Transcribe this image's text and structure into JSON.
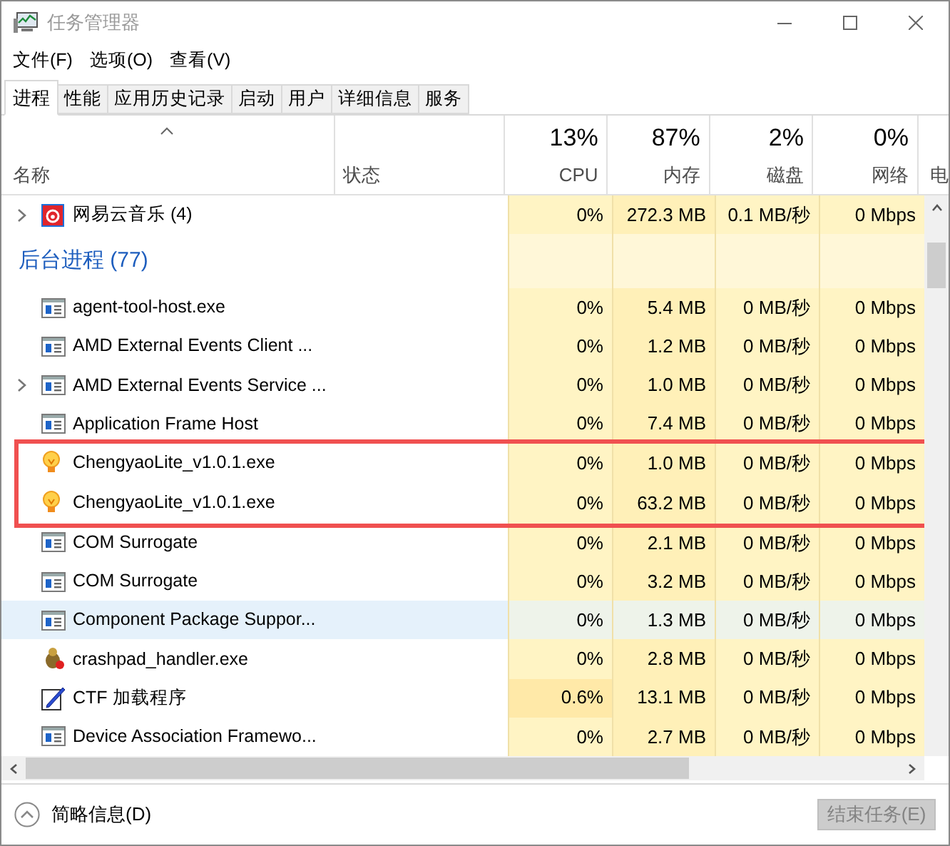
{
  "window": {
    "title": "任务管理器"
  },
  "menu": [
    "文件(F)",
    "选项(O)",
    "查看(V)"
  ],
  "tabs": [
    {
      "label": "进程",
      "selected": true
    },
    {
      "label": "性能",
      "selected": false
    },
    {
      "label": "应用历史记录",
      "selected": false
    },
    {
      "label": "启动",
      "selected": false
    },
    {
      "label": "用户",
      "selected": false
    },
    {
      "label": "详细信息",
      "selected": false
    },
    {
      "label": "服务",
      "selected": false
    }
  ],
  "columns": [
    {
      "label": "名称"
    },
    {
      "label": "状态"
    },
    {
      "label": "CPU",
      "percent": "13%"
    },
    {
      "label": "内存",
      "percent": "87%"
    },
    {
      "label": "磁盘",
      "percent": "2%"
    },
    {
      "label": "网络",
      "percent": "0%"
    },
    {
      "label": "电"
    }
  ],
  "rows": [
    {
      "kind": "music",
      "name": "网易云音乐 (4)",
      "expandable": true,
      "selected": false,
      "highlighted": false,
      "cpu": "0%",
      "memory": "272.3 MB",
      "disk": "0.1 MB/秒",
      "network": "0 Mbps"
    },
    {
      "kind": "group",
      "name": "后台进程 (77)"
    },
    {
      "kind": "window",
      "name": "agent-tool-host.exe",
      "expandable": false,
      "selected": false,
      "highlighted": false,
      "cpu": "0%",
      "memory": "5.4 MB",
      "disk": "0 MB/秒",
      "network": "0 Mbps"
    },
    {
      "kind": "window",
      "name": "AMD External Events Client ...",
      "expandable": false,
      "selected": false,
      "highlighted": false,
      "cpu": "0%",
      "memory": "1.2 MB",
      "disk": "0 MB/秒",
      "network": "0 Mbps"
    },
    {
      "kind": "window",
      "name": "AMD External Events Service ...",
      "expandable": true,
      "selected": false,
      "highlighted": false,
      "cpu": "0%",
      "memory": "1.0 MB",
      "disk": "0 MB/秒",
      "network": "0 Mbps"
    },
    {
      "kind": "window",
      "name": "Application Frame Host",
      "expandable": false,
      "selected": false,
      "highlighted": false,
      "cpu": "0%",
      "memory": "7.4 MB",
      "disk": "0 MB/秒",
      "network": "0 Mbps"
    },
    {
      "kind": "bulb",
      "name": "ChengyaoLite_v1.0.1.exe",
      "expandable": false,
      "selected": false,
      "highlighted": true,
      "cpu": "0%",
      "memory": "1.0 MB",
      "disk": "0 MB/秒",
      "network": "0 Mbps"
    },
    {
      "kind": "bulb",
      "name": "ChengyaoLite_v1.0.1.exe",
      "expandable": false,
      "selected": false,
      "highlighted": true,
      "cpu": "0%",
      "memory": "63.2 MB",
      "disk": "0 MB/秒",
      "network": "0 Mbps"
    },
    {
      "kind": "window",
      "name": "COM Surrogate",
      "expandable": false,
      "selected": false,
      "highlighted": false,
      "cpu": "0%",
      "memory": "2.1 MB",
      "disk": "0 MB/秒",
      "network": "0 Mbps"
    },
    {
      "kind": "window",
      "name": "COM Surrogate",
      "expandable": false,
      "selected": false,
      "highlighted": false,
      "cpu": "0%",
      "memory": "3.2 MB",
      "disk": "0 MB/秒",
      "network": "0 Mbps"
    },
    {
      "kind": "window",
      "name": "Component Package Suppor...",
      "expandable": false,
      "selected": true,
      "highlighted": false,
      "cpu": "0%",
      "memory": "1.3 MB",
      "disk": "0 MB/秒",
      "network": "0 Mbps"
    },
    {
      "kind": "bug",
      "name": "crashpad_handler.exe",
      "expandable": false,
      "selected": false,
      "highlighted": false,
      "cpu": "0%",
      "memory": "2.8 MB",
      "disk": "0 MB/秒",
      "network": "0 Mbps"
    },
    {
      "kind": "pen",
      "name": "CTF 加载程序",
      "expandable": false,
      "selected": false,
      "highlighted": false,
      "cpu": "0.6%",
      "memory": "13.1 MB",
      "disk": "0 MB/秒",
      "network": "0 Mbps"
    },
    {
      "kind": "window",
      "name": "Device Association Framewo...",
      "expandable": false,
      "selected": false,
      "highlighted": false,
      "cpu": "0%",
      "memory": "2.7 MB",
      "disk": "0 MB/秒",
      "network": "0 Mbps"
    }
  ],
  "footer": {
    "toggle": "简略信息(D)",
    "end_task": {
      "label": "结束任务(E)",
      "disabled": true
    }
  }
}
